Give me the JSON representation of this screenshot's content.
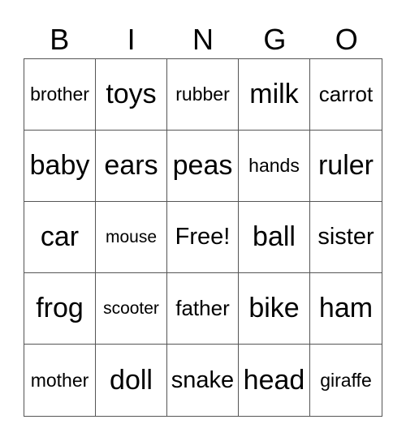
{
  "header": [
    "B",
    "I",
    "N",
    "G",
    "O"
  ],
  "cells": [
    "brother",
    "toys",
    "rubber",
    "milk",
    "carrot",
    "baby",
    "ears",
    "peas",
    "hands",
    "ruler",
    "car",
    "mouse",
    "Free!",
    "ball",
    "sister",
    "frog",
    "scooter",
    "father",
    "bike",
    "ham",
    "mother",
    "doll",
    "snake",
    "head",
    "giraffe"
  ]
}
